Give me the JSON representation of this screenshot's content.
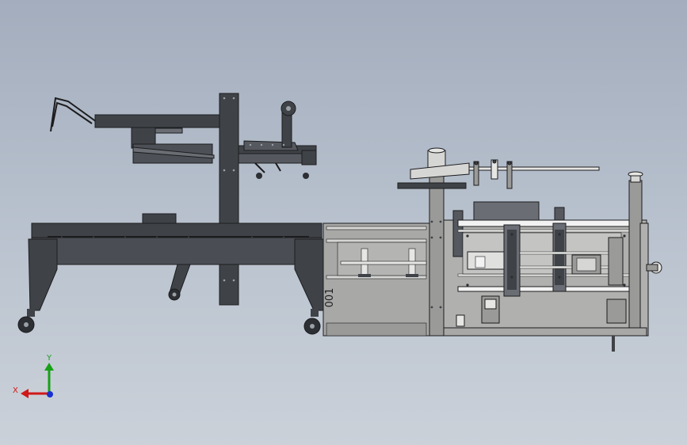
{
  "viewport": {
    "background_top": "#a3adbd",
    "background_bottom": "#cbd1d9"
  },
  "model": {
    "part_marking": "001"
  },
  "triad": {
    "x_label": "X",
    "y_label": "Y",
    "x_color": "#d01818",
    "y_color": "#18a018",
    "z_color": "#1830d0"
  },
  "colors": {
    "frame_dark": "#3f4348",
    "frame_mid": "#55595f",
    "panel_grey": "#9a9a98",
    "panel_light": "#b4b4b2",
    "steel_white": "#f2f2f2",
    "outline": "#1c1c1e"
  }
}
